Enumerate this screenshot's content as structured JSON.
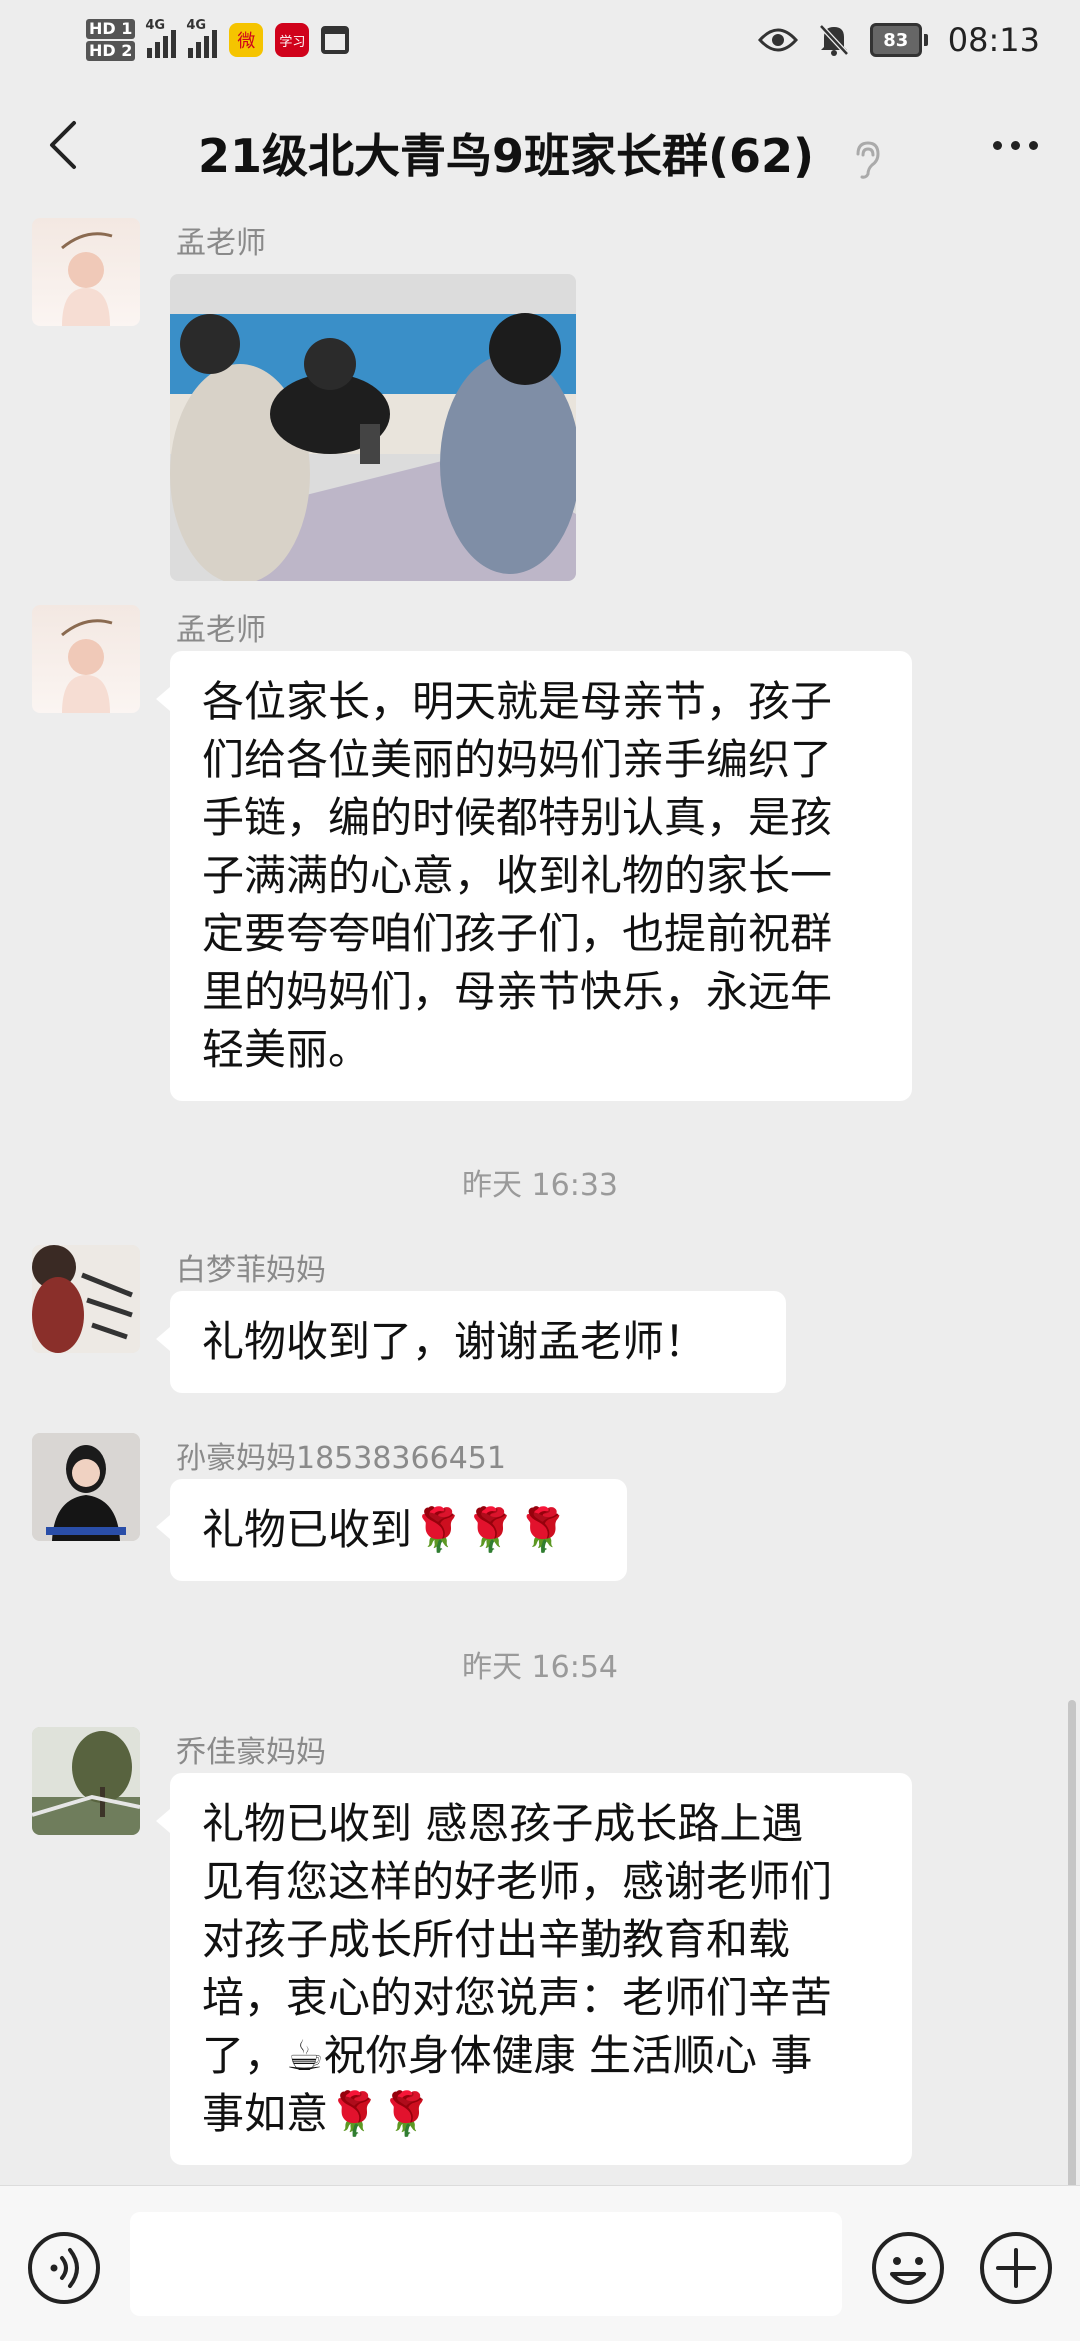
{
  "status_bar": {
    "hd1": "HD 1",
    "hd2": "HD 2",
    "sig1": "4G",
    "sig2": "4G",
    "weibo": "微",
    "news": "学习",
    "battery": "83",
    "time": "08:13"
  },
  "header": {
    "title": "21级北大青鸟9班家长群(62)"
  },
  "messages": [
    {
      "sender": "孟老师",
      "type": "image"
    },
    {
      "sender": "孟老师",
      "lines": [
        "各位家长，明天就是母亲节，孩子",
        "们给各位美丽的妈妈们亲手编织了",
        "手链，编的时候都特别认真，是孩",
        "子满满的心意，收到礼物的家长一",
        "定要夸夸咱们孩子们，也提前祝群",
        "里的妈妈们，母亲节快乐，永远年",
        "轻美丽。"
      ]
    },
    {
      "sender": "白梦菲妈妈",
      "text": "礼物收到了，谢谢孟老师！"
    },
    {
      "sender": "孙豪妈妈18538366451",
      "text": "礼物已收到🌹🌹🌹"
    },
    {
      "sender": "乔佳豪妈妈",
      "lines": [
        "礼物已收到   感恩孩子成长路上遇",
        "见有您这样的好老师，感谢老师们",
        "对孩子成长所付出辛勤教育和载",
        "培，衷心的对您说声：老师们辛苦",
        "了，☕祝你身体健康 生活顺心 事",
        "事如意🌹🌹"
      ]
    }
  ],
  "time_separators": [
    "昨天 16:33",
    "昨天 16:54"
  ],
  "input": {
    "placeholder": ""
  }
}
